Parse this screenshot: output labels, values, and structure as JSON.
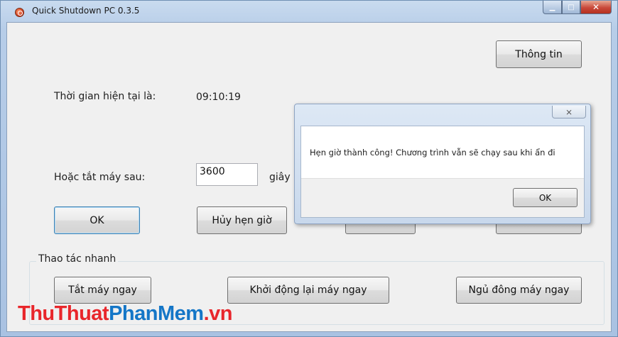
{
  "window": {
    "title": "Quick Shutdown PC 0.3.5",
    "minimize": "▁",
    "maximize": "□",
    "close": "✕"
  },
  "main": {
    "about_button": "Thông tin",
    "current_time_label": "Thời gian hiện tại là:",
    "current_time_value": "09:10:19",
    "shutdown_after_label": "Hoặc tắt máy sau:",
    "seconds_value": "3600",
    "seconds_unit": "giây",
    "ok_button": "OK",
    "cancel_timer_button": "Hủy hẹn giờ"
  },
  "quick_actions": {
    "title": "Thao tác nhanh",
    "shutdown_now": "Tắt máy ngay",
    "restart_now": "Khởi động lại máy ngay",
    "hibernate_now": "Ngủ đông máy ngay"
  },
  "dialog": {
    "close": "⨯",
    "message": "Hẹn giờ thành công! Chương trình vẫn sẽ chạy sau khi ẩn đi",
    "ok_button": "OK"
  },
  "watermark": {
    "part1": "ThuThuat",
    "part2": "PhanMem",
    "part3": ".vn"
  },
  "colors": {
    "accent": "#3c7fb1",
    "watermark_red": "#e8262b",
    "watermark_blue": "#1476c7"
  }
}
